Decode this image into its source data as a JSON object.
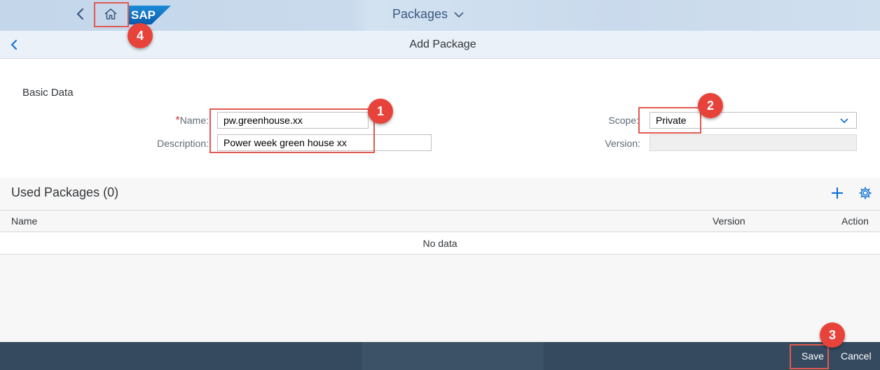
{
  "shell": {
    "title": "Packages",
    "logo_text": "SAP",
    "icons": {
      "back": "chevron-left-icon",
      "home": "home-icon",
      "title_dropdown": "chevron-down-icon"
    }
  },
  "subheader": {
    "title": "Add Package",
    "back_icon": "chevron-left-icon"
  },
  "form": {
    "section_title": "Basic Data",
    "required_marker": "*",
    "name_label": "Name:",
    "name_value": "pw.greenhouse.xx",
    "description_label": "Description:",
    "description_value": "Power week green house xx",
    "scope_label": "Scope:",
    "scope_value": "Private",
    "version_label": "Version:",
    "version_value": ""
  },
  "used_packages": {
    "title": "Used Packages (0)",
    "columns": [
      "Name",
      "Version",
      "Action"
    ],
    "empty_text": "No data",
    "icons": {
      "add": "add-icon",
      "settings": "gear-icon"
    }
  },
  "footer": {
    "save_label": "Save",
    "cancel_label": "Cancel"
  },
  "annotations": {
    "badges": [
      "1",
      "2",
      "3",
      "4"
    ],
    "color": "#e8433a"
  },
  "colors": {
    "shell_bg": "#c9daec",
    "footer_bg": "#354a5f",
    "accent": "#0a6ed1",
    "required": "#cc3333"
  }
}
